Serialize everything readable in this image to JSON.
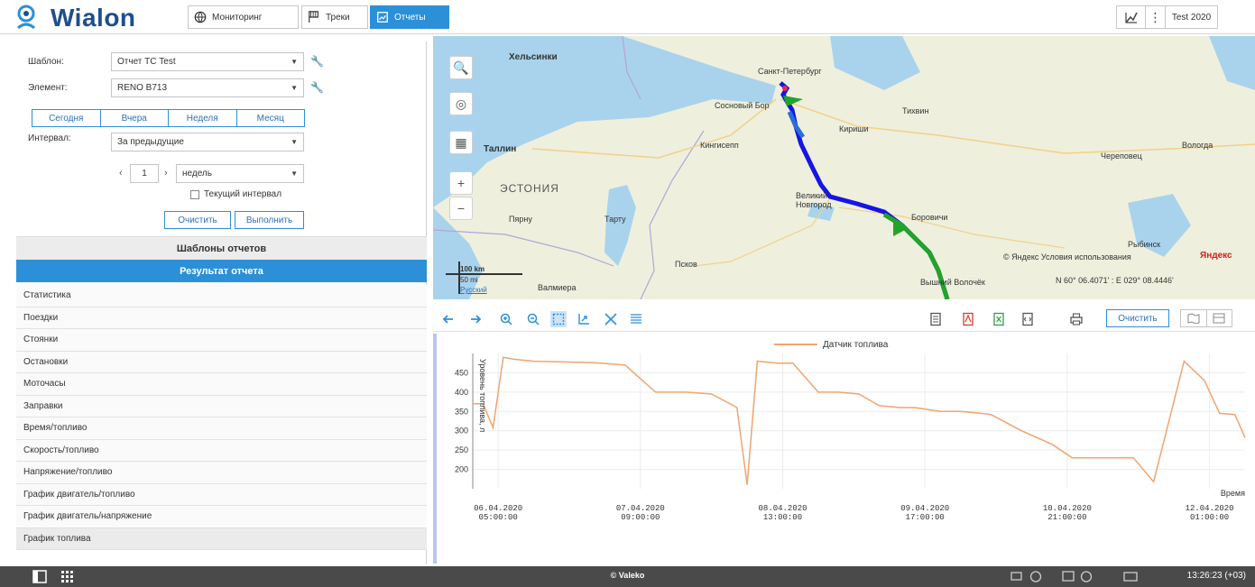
{
  "app": {
    "logo_text": "Wialon",
    "user": "Test 2020"
  },
  "tabs": [
    {
      "label": "Мониторинг"
    },
    {
      "label": "Треки"
    },
    {
      "label": "Отчеты"
    }
  ],
  "form": {
    "template_label": "Шаблон:",
    "template_value": "Отчет ТС Test",
    "element_label": "Элемент:",
    "element_value": "RENO B713",
    "period_buttons": [
      "Сегодня",
      "Вчера",
      "Неделя",
      "Месяц"
    ],
    "interval_label": "Интервал:",
    "interval_value": "За предыдущие",
    "count_value": "1",
    "unit_value": "недель",
    "current_interval_label": "Текущий интервал",
    "clear_label": "Очистить",
    "run_label": "Выполнить"
  },
  "sections": {
    "templates_header": "Шаблоны отчетов",
    "result_header": "Результат отчета"
  },
  "result_tables": [
    "Статистика",
    "Поездки",
    "Стоянки",
    "Остановки",
    "Моточасы",
    "Заправки",
    "Время/топливо",
    "Скорость/топливо",
    "Напряжение/топливо",
    "График двигатель/топливо",
    "График двигатель/напряжение",
    "График топлива"
  ],
  "map": {
    "cities": [
      "Хельсинки",
      "Санкт-Петербург",
      "Сосновый Бор",
      "Таллин",
      "Кингисепп",
      "Кириши",
      "Тихвин",
      "Череповец",
      "Вологда",
      "ЭСТОНИЯ",
      "Пярну",
      "Тарту",
      "Великий Новгород",
      "Боровичи",
      "Псков",
      "Валмиера",
      "Вышний Волочёк",
      "Рыбинск"
    ],
    "copyright": "© Яндекс Условия использования",
    "coords": "N 60° 06.4071' : E 029° 08.4446'",
    "scale_km": "100 km",
    "scale_mi": "50 mi",
    "scale_link": "Русский",
    "brand": "Яндекс"
  },
  "chart_toolbar": {
    "clear_label": "Очистить"
  },
  "chart_data": {
    "type": "line",
    "series": [
      {
        "name": "Датчик топлива",
        "color": "#f0a470",
        "x": [
          "2020-04-06 00:00",
          "2020-04-06 02:00",
          "2020-04-06 04:00",
          "2020-04-06 06:00",
          "2020-04-06 08:00",
          "2020-04-06 12:00",
          "2020-04-06 18:00",
          "2020-04-07 00:00",
          "2020-04-07 06:00",
          "2020-04-07 12:00",
          "2020-04-07 18:00",
          "2020-04-07 21:00",
          "2020-04-07 23:00",
          "2020-04-08 04:00",
          "2020-04-08 06:00",
          "2020-04-08 08:00",
          "2020-04-08 12:00",
          "2020-04-08 15:00",
          "2020-04-08 18:00",
          "2020-04-08 20:00",
          "2020-04-09 00:00",
          "2020-04-09 04:00",
          "2020-04-09 08:00",
          "2020-04-09 12:00",
          "2020-04-09 15:00",
          "2020-04-09 20:00",
          "2020-04-10 00:00",
          "2020-04-10 04:00",
          "2020-04-10 06:00",
          "2020-04-10 12:00",
          "2020-04-10 18:00",
          "2020-04-10 22:00",
          "2020-04-11 06:00",
          "2020-04-11 10:00",
          "2020-04-11 14:00",
          "2020-04-11 20:00",
          "2020-04-12 00:00",
          "2020-04-12 03:00",
          "2020-04-12 06:00",
          "2020-04-12 08:00"
        ],
        "values": [
          370,
          370,
          308,
          490,
          485,
          480,
          478,
          476,
          470,
          400,
          400,
          397,
          395,
          360,
          160,
          480,
          475,
          475,
          430,
          400,
          400,
          395,
          365,
          360,
          360,
          350,
          350,
          345,
          342,
          300,
          265,
          230,
          230,
          230,
          168,
          480,
          430,
          345,
          342,
          282
        ]
      }
    ],
    "x_ticks": [
      "06.04.2020 05:00:00",
      "07.04.2020 09:00:00",
      "08.04.2020 13:00:00",
      "09.04.2020 17:00:00",
      "10.04.2020 21:00:00",
      "12.04.2020 01:00:00"
    ],
    "y_ticks": [
      200,
      250,
      300,
      350,
      400,
      450
    ],
    "ylim": [
      150,
      500
    ],
    "xlabel": "Время",
    "ylabel": "Уровень топлива, л",
    "legend": "top-center",
    "grid": true
  },
  "bottom": {
    "copyright": "© Valeko",
    "clock": "13:26:23 (+03)"
  }
}
